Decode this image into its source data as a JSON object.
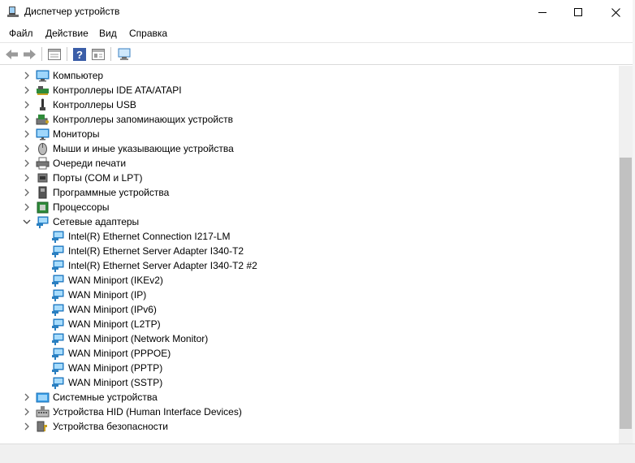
{
  "window": {
    "title": "Диспетчер устройств"
  },
  "menu": [
    "Файл",
    "Действие",
    "Вид",
    "Справка"
  ],
  "tree": [
    {
      "label": "Компьютер",
      "icon": "computer-icon",
      "expanded": false
    },
    {
      "label": "Контроллеры IDE ATA/ATAPI",
      "icon": "ide-controller-icon",
      "expanded": false
    },
    {
      "label": "Контроллеры USB",
      "icon": "usb-icon",
      "expanded": false
    },
    {
      "label": "Контроллеры запоминающих устройств",
      "icon": "storage-controller-icon",
      "expanded": false
    },
    {
      "label": "Мониторы",
      "icon": "monitor-icon",
      "expanded": false
    },
    {
      "label": "Мыши и иные указывающие устройства",
      "icon": "mouse-icon",
      "expanded": false
    },
    {
      "label": "Очереди печати",
      "icon": "printer-icon",
      "expanded": false
    },
    {
      "label": "Порты (COM и LPT)",
      "icon": "port-icon",
      "expanded": false
    },
    {
      "label": "Программные устройства",
      "icon": "software-device-icon",
      "expanded": false
    },
    {
      "label": "Процессоры",
      "icon": "processor-icon",
      "expanded": false
    },
    {
      "label": "Сетевые адаптеры",
      "icon": "network-adapter-icon",
      "expanded": true,
      "children": [
        "Intel(R) Ethernet Connection I217-LM",
        "Intel(R) Ethernet Server Adapter I340-T2",
        "Intel(R) Ethernet Server Adapter I340-T2 #2",
        "WAN Miniport (IKEv2)",
        "WAN Miniport (IP)",
        "WAN Miniport (IPv6)",
        "WAN Miniport (L2TP)",
        "WAN Miniport (Network Monitor)",
        "WAN Miniport (PPPOE)",
        "WAN Miniport (PPTP)",
        "WAN Miniport (SSTP)"
      ]
    },
    {
      "label": "Системные устройства",
      "icon": "system-device-icon",
      "expanded": false
    },
    {
      "label": "Устройства HID (Human Interface Devices)",
      "icon": "hid-icon",
      "expanded": false
    },
    {
      "label": "Устройства безопасности",
      "icon": "security-device-icon",
      "expanded": false
    }
  ],
  "colors": {
    "accent": "#1e90d8",
    "network_icon": "#2a8fd6"
  }
}
